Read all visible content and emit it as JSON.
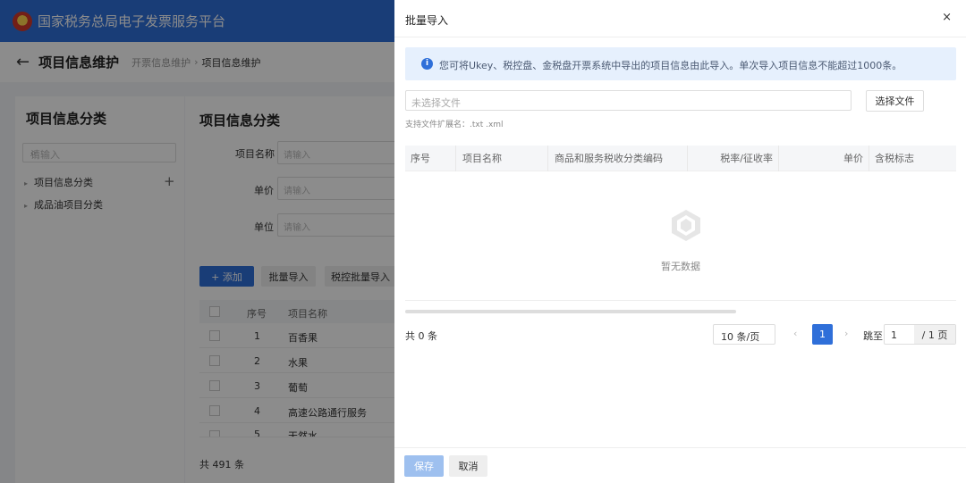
{
  "app": {
    "title": "国家税务总局电子发票服务平台"
  },
  "subbar": {
    "back_icon": "←",
    "title": "项目信息维护",
    "crumb_parent": "开票信息维护",
    "crumb_sep": "›",
    "crumb_current": "项目信息维护"
  },
  "left": {
    "title": "项目信息分类",
    "search_placeholder": "请输入",
    "tree": [
      {
        "label": "项目信息分类"
      },
      {
        "label": "成品油项目分类"
      }
    ]
  },
  "right": {
    "title": "项目信息分类",
    "filters": [
      {
        "label": "项目名称",
        "placeholder": "请输入"
      },
      {
        "label": "单价",
        "placeholder": "请输入"
      },
      {
        "label": "单位",
        "placeholder": "请输入"
      }
    ],
    "buttons": {
      "add": "+ 添加",
      "batch": "批量导入",
      "tax_batch": "税控批量导入"
    },
    "table": {
      "headers": [
        "序号",
        "项目名称"
      ],
      "rows": [
        {
          "no": "1",
          "name": "百香果"
        },
        {
          "no": "2",
          "name": "水果"
        },
        {
          "no": "3",
          "name": "葡萄"
        },
        {
          "no": "4",
          "name": "高速公路通行服务"
        },
        {
          "no": "5",
          "name": "天然水"
        }
      ]
    },
    "total": "共 491 条"
  },
  "drawer": {
    "title": "批量导入",
    "close": "×",
    "alert": "您可将Ukey、税控盘、金税盘开票系统中导出的项目信息由此导入。单次导入项目信息不能超过1000条。",
    "file_placeholder": "未选择文件",
    "choose_button": "选择文件",
    "hint": "支持文件扩展名：.txt .xml",
    "columns": [
      "序号",
      "项目名称",
      "商品和服务税收分类编码",
      "税率/征收率",
      "单价",
      "含税标志"
    ],
    "empty": "暂无数据",
    "pagination": {
      "total": "共 0 条",
      "page_size": "10 条/页",
      "prev": "‹",
      "current": "1",
      "next": "›",
      "jump_label": "跳至",
      "jump_value": "1",
      "page_suffix": "/ 1 页"
    },
    "footer": {
      "save": "保存",
      "cancel": "取消"
    }
  }
}
